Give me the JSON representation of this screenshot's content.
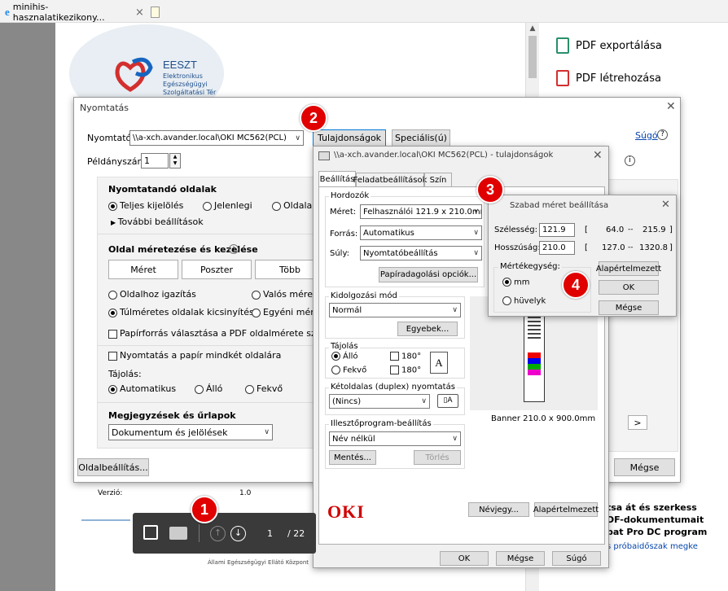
{
  "browser": {
    "tab_title": "minihis-hasznalatikezikony...",
    "close_tab": "×"
  },
  "acrobat_panel": {
    "export": "PDF exportálása",
    "create": "PDF létrehozása"
  },
  "logo": {
    "name": "EESZT",
    "line1": "Elektronikus",
    "line2": "Egészségügyi",
    "line3": "Szolgáltatási Tér"
  },
  "doc_bg": {
    "verzio_label": "Verzió:",
    "verzio_value": "1.0",
    "footer": "Állami Egészségügyi Ellátó Központ",
    "right_text1": "tsa át és szerkess",
    "right_text2": "DF-dokumentumait",
    "right_text3": "bat Pro DC program",
    "right_text4": "s próbaidőszak megke"
  },
  "page_toolbar": {
    "current_page": "1",
    "total_pages": "/ 22"
  },
  "print_dialog": {
    "title": "Nyomtatás",
    "printer_label": "Nyomtató:",
    "printer_value": "\\\\a-xch.avander.local\\OKI MC562(PCL)",
    "properties_button": "Tulajdonságok",
    "special_button": "Speciális(ú)",
    "help_link": "Súgó",
    "copies_label": "Példányszám:",
    "copies_value": "1",
    "pages_title": "Nyomtatandó oldalak",
    "all": "Teljes kijelölés",
    "current": "Jelenlegi",
    "pages": "Oldalak",
    "more": "További beállítások",
    "sizing_title": "Oldal méretezése és kezelése",
    "size_btn": "Méret",
    "poster_btn": "Poszter",
    "multiple_btn": "Több",
    "fit": "Oldalhoz igazítás",
    "actual": "Valós méret",
    "shrink": "Túlméretes oldalak kicsinyítése",
    "custom": "Egyéni méret",
    "paper_source": "Papírforrás választása a PDF oldalmérete szerint",
    "duplex": "Nyomtatás a papír mindkét oldalára",
    "orientation_label": "Tájolás:",
    "auto": "Automatikus",
    "portrait": "Álló",
    "landscape": "Fekvő",
    "comments_title": "Megjegyzések és űrlapok",
    "comments_value": "Dokumentum és jelölések",
    "page_setup": "Oldalbeállítás...",
    "cancel": "Mégse"
  },
  "props_dialog": {
    "title": "\\\\a-xch.avander.local\\OKI MC562(PCL) - tulajdonságok",
    "tab_setup": "Beállítás",
    "tab_job": "Feladatbeállítások",
    "tab_color": "Szín",
    "media_group": "Hordozók",
    "size_label": "Méret:",
    "size_value": "Felhasználói 121.9 x 210.0mm...",
    "source_label": "Forrás:",
    "source_value": "Automatikus",
    "weight_label": "Súly:",
    "weight_value": "Nyomtatóbeállítás",
    "paper_feed_btn": "Papíradagolási opciók...",
    "finish_group": "Kidolgozási mód",
    "finish_value": "Normál",
    "other_btn": "Egyebek...",
    "orient_group": "Tájolás",
    "portrait": "Álló",
    "landscape": "Fekvő",
    "rot180": "180°",
    "duplex_group": "Kétoldalas (duplex) nyomtatás",
    "duplex_value": "(Nincs)",
    "driver_group": "Illesztőprogram-beállítás",
    "driver_value": "Név nélkül",
    "save_btn": "Mentés...",
    "delete_btn": "Törlés",
    "preview_caption": "Banner 210.0 x 900.0mm",
    "brand": "OKI",
    "about_btn": "Névjegy...",
    "default_btn": "Alapértelmezett",
    "ok": "OK",
    "cancel": "Mégse",
    "help": "Súgó"
  },
  "custom_dialog": {
    "title": "Szabad méret beállítása",
    "width_label": "Szélesség:",
    "width_value": "121.9",
    "width_range_min": "64.0",
    "width_range_max": "215.9",
    "height_label": "Hosszúság:",
    "height_value": "210.0",
    "height_range_min": "127.0",
    "height_range_max": "1320.8",
    "unit_group": "Mértékegység:",
    "mm": "mm",
    "inch": "hüvelyk",
    "default_btn": "Alapértelmezett",
    "ok": "OK",
    "cancel": "Mégse",
    "lbracket": "[",
    "rbracket": "]",
    "dash": "--"
  },
  "badges": {
    "b1": "1",
    "b2": "2",
    "b3": "3",
    "b4": "4"
  },
  "colors": {
    "badge": "#e00000",
    "oki_red": "#d00000",
    "link": "#0645ad",
    "toolbar": "#3a3a3a"
  }
}
